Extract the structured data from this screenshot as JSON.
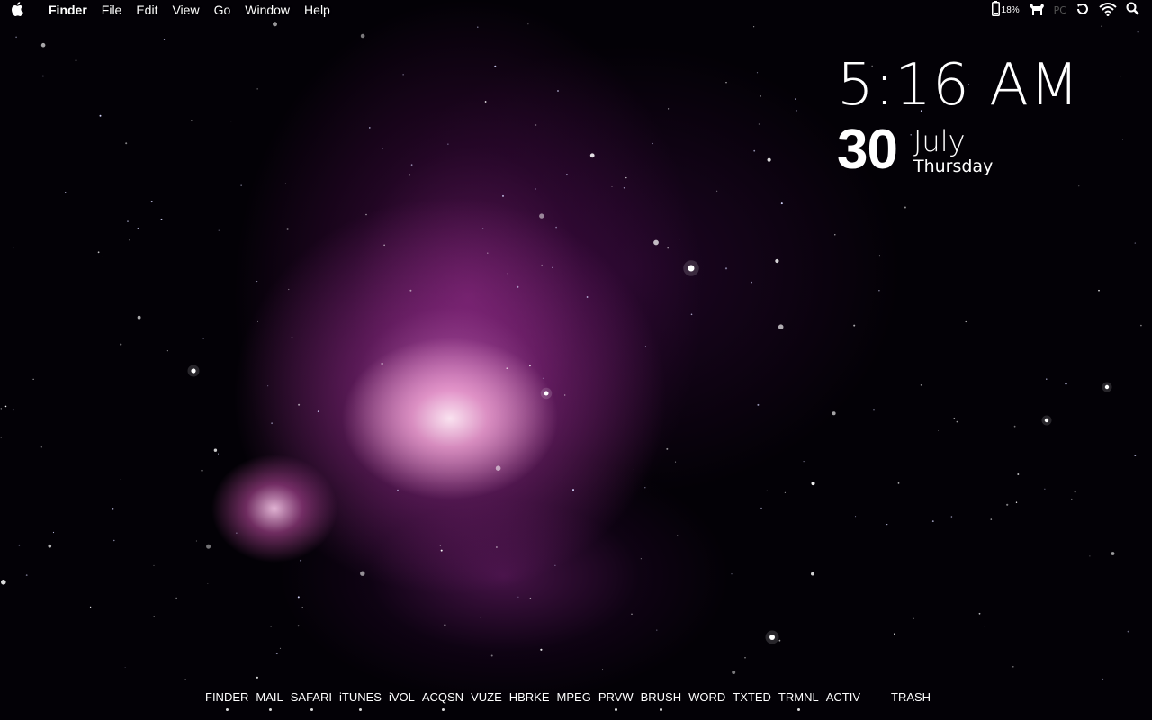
{
  "menubar": {
    "apple_icon": "apple-logo-icon",
    "app_name": "Finder",
    "items": [
      "File",
      "Edit",
      "View",
      "Go",
      "Window",
      "Help"
    ],
    "status": {
      "battery_percent": "18%",
      "pc_label": "PC",
      "icons": [
        "battery-icon",
        "dog-icon",
        "pc-icon",
        "time-machine-icon",
        "wifi-icon",
        "spotlight-icon"
      ]
    }
  },
  "clock": {
    "time": "5:16 AM",
    "day": "30",
    "month": "July",
    "weekday": "Thursday"
  },
  "dock": {
    "items": [
      {
        "label": "FINDER",
        "running": true
      },
      {
        "label": "MAIL",
        "running": true
      },
      {
        "label": "SAFARI",
        "running": true
      },
      {
        "label": "iTUNES",
        "running": true
      },
      {
        "label": "iVOL",
        "running": false
      },
      {
        "label": "ACQSN",
        "running": true
      },
      {
        "label": "VUZE",
        "running": false
      },
      {
        "label": "HBRKE",
        "running": false
      },
      {
        "label": "MPEG",
        "running": false
      },
      {
        "label": "PRVW",
        "running": true
      },
      {
        "label": "BRUSH",
        "running": true
      },
      {
        "label": "WORD",
        "running": false
      },
      {
        "label": "TXTED",
        "running": false
      },
      {
        "label": "TRMNL",
        "running": true
      },
      {
        "label": "ACTIV",
        "running": false
      }
    ],
    "trash_label": "TRASH"
  },
  "colors": {
    "nebula_core": "#f5c8e6",
    "nebula_mid": "#b83ca8",
    "background": "#030106"
  }
}
